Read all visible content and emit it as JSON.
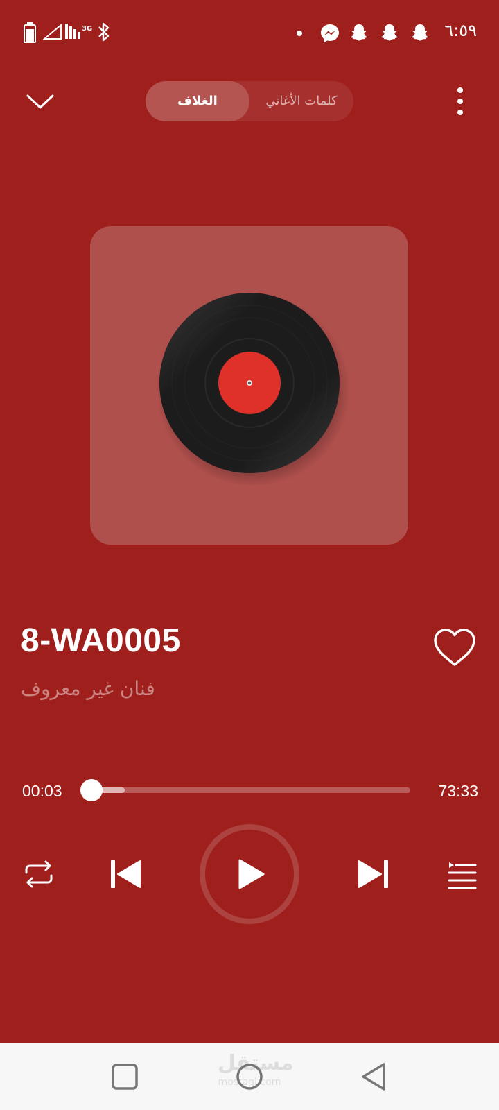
{
  "status_bar": {
    "time": "٦:٥٩",
    "network_label": "3G",
    "icons": [
      "battery-icon",
      "signal-icon",
      "signal-bars-icon",
      "bluetooth-icon",
      "dot-icon",
      "messenger-icon",
      "snapchat-icon",
      "snapchat-icon",
      "snapchat-icon"
    ]
  },
  "top_bar": {
    "tabs": [
      {
        "label": "الغلاف",
        "active": true
      },
      {
        "label": "كلمات الأغاني",
        "active": false
      }
    ]
  },
  "track": {
    "title": "8-WA0005",
    "artist": "فنان غير معروف",
    "favorite": false
  },
  "progress": {
    "elapsed": "00:03",
    "total": "73:33",
    "fraction": 0.0007
  },
  "controls": {
    "state": "paused",
    "icons": [
      "repeat-icon",
      "previous-icon",
      "play-icon",
      "next-icon",
      "queue-icon"
    ]
  },
  "nav_bar": {
    "watermark": "مستقل",
    "watermark_sub": "mostaql.com"
  },
  "colors": {
    "background": "#9e1f1c",
    "artwork_card": "#b0504d",
    "vinyl_label": "#e0302a",
    "nav_bar": "#f7f7f7"
  }
}
